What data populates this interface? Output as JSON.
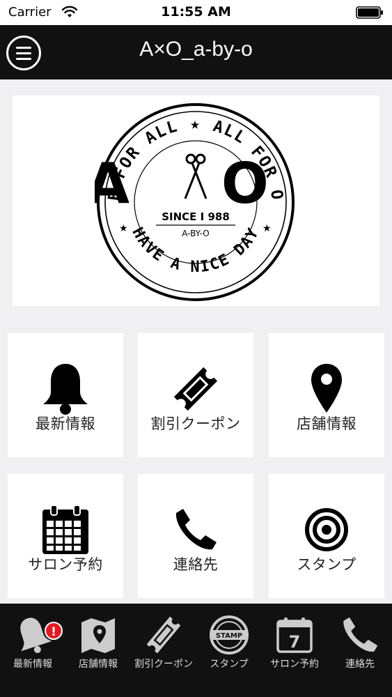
{
  "status": {
    "carrier": "Carrier",
    "time": "11:55 AM"
  },
  "header": {
    "title": "A×O_a-by-o"
  },
  "logo": {
    "top_arc": "ONE FOR ALL ★ ALL FOR ONE",
    "bottom_arc": "HAVE A NICE DAY",
    "mark": "A O",
    "since": "SINCE I 988",
    "sub": "A-BY-O"
  },
  "grid": [
    {
      "label": "最新情報",
      "icon": "bell-icon"
    },
    {
      "label": "割引クーポン",
      "icon": "ticket-icon"
    },
    {
      "label": "店舗情報",
      "icon": "map-pin-icon"
    },
    {
      "label": "サロン予約",
      "icon": "calendar-icon"
    },
    {
      "label": "連絡先",
      "icon": "phone-icon"
    },
    {
      "label": "スタンプ",
      "icon": "target-icon"
    }
  ],
  "tabs": [
    {
      "label": "最新情報",
      "icon": "bell-icon",
      "badge": "!"
    },
    {
      "label": "店舗情報",
      "icon": "map-icon"
    },
    {
      "label": "割引クーポン",
      "icon": "ticket-icon"
    },
    {
      "label": "スタンプ",
      "icon": "stamp-icon",
      "icon_text": "STAMP"
    },
    {
      "label": "サロン予約",
      "icon": "calendar-icon",
      "icon_text": "7"
    },
    {
      "label": "連絡先",
      "icon": "phone-icon"
    }
  ]
}
